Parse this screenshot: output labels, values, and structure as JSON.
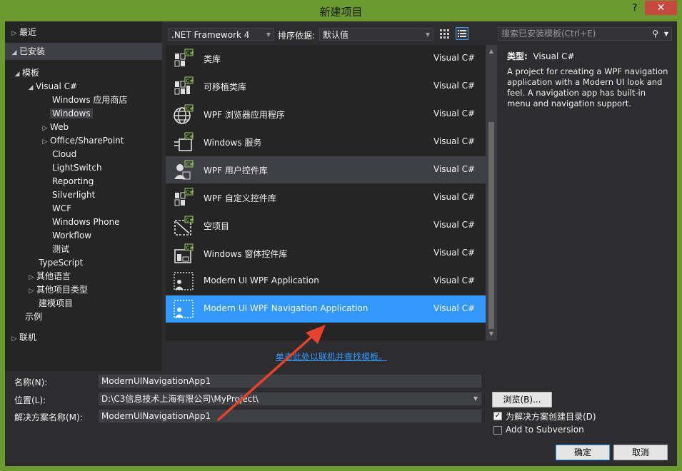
{
  "window": {
    "title": "新建项目",
    "help": "?",
    "close": "✕"
  },
  "tree": {
    "recent": "最近",
    "installed": "已安装",
    "templates": "模板",
    "visual_csharp": "Visual C#",
    "items": [
      "Windows 应用商店",
      "Windows",
      "Web",
      "Office/SharePoint",
      "Cloud",
      "LightSwitch",
      "Reporting",
      "Silverlight",
      "WCF",
      "Windows Phone",
      "Workflow",
      "测试"
    ],
    "typescript": "TypeScript",
    "other_languages": "其他语言",
    "other_project_types": "其他项目类型",
    "modeling": "建模项目",
    "samples": "示例",
    "online": "联机"
  },
  "toolbar": {
    "framework": ".NET Framework 4",
    "sort_label": "排序依据:",
    "sort_value": "默认值",
    "search_placeholder": "搜索已安装模板(Ctrl+E)"
  },
  "templates": [
    {
      "name": "类库",
      "lang": "Visual C#",
      "icon": "class-library-icon"
    },
    {
      "name": "可移植类库",
      "lang": "Visual C#",
      "icon": "portable-library-icon"
    },
    {
      "name": "WPF 浏览器应用程序",
      "lang": "Visual C#",
      "icon": "globe-icon"
    },
    {
      "name": "Windows 服务",
      "lang": "Visual C#",
      "icon": "service-icon"
    },
    {
      "name": "WPF 用户控件库",
      "lang": "Visual C#",
      "icon": "user-control-icon"
    },
    {
      "name": "WPF 自定义控件库",
      "lang": "Visual C#",
      "icon": "custom-control-icon"
    },
    {
      "name": "空项目",
      "lang": "Visual C#",
      "icon": "empty-project-icon"
    },
    {
      "name": "Windows 窗体控件库",
      "lang": "Visual C#",
      "icon": "forms-control-icon"
    },
    {
      "name": "Modern UI WPF Application",
      "lang": "Visual C#",
      "icon": "modern-ui-icon"
    },
    {
      "name": "Modern UI WPF Navigation Application",
      "lang": "Visual C#",
      "icon": "modern-ui-nav-icon"
    }
  ],
  "online_link": "单击此处以联机并查找模板。",
  "description": {
    "type_label": "类型:",
    "type_value": "Visual C#",
    "text": "A project for creating a WPF navigation application with a Modern UI look and feel. A navigation app has built-in menu and navigation support."
  },
  "form": {
    "name_label": "名称(N):",
    "name_value": "ModernUINavigationApp1",
    "location_label": "位置(L):",
    "location_value": "D:\\C3信息技术上海有限公司\\MyProject\\",
    "solution_label": "解决方案名称(M):",
    "solution_value": "ModernUINavigationApp1",
    "browse": "浏览(B)...",
    "create_dir": "为解决方案创建目录(D)",
    "add_svn": "Add to Subversion",
    "ok": "确定",
    "cancel": "取消"
  },
  "colors": {
    "accent": "#3399ff",
    "title_bar": "#6c9a30",
    "close": "#c7483f",
    "annotation_arrow": "#e8412c"
  }
}
